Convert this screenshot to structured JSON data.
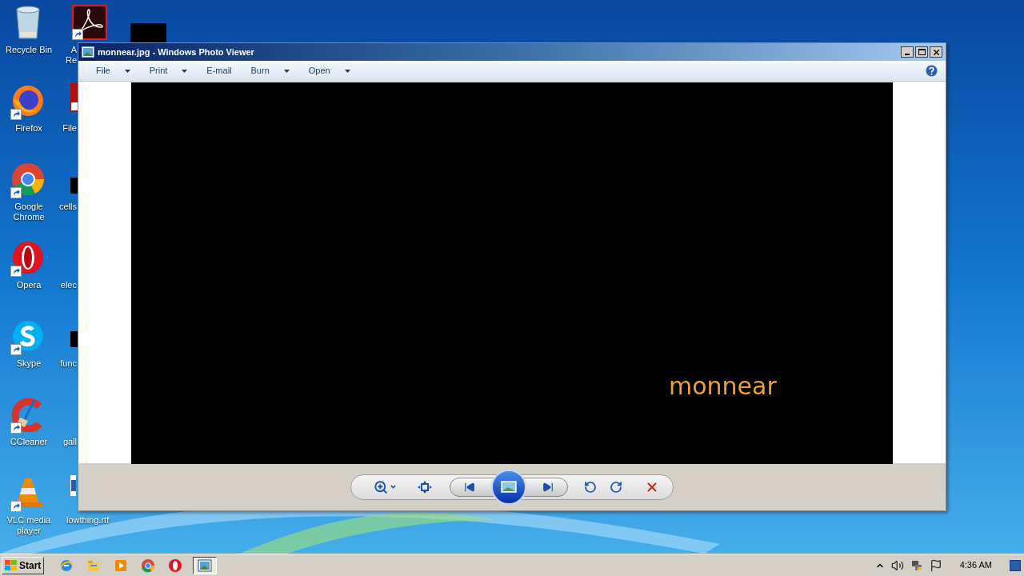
{
  "desktop_icons": [
    {
      "label": "Recycle Bin",
      "shortcut": false
    },
    {
      "label": "Firefox",
      "shortcut": true
    },
    {
      "label": "Google Chrome",
      "shortcut": true
    },
    {
      "label": "Opera",
      "shortcut": true
    },
    {
      "label": "Skype",
      "shortcut": true
    },
    {
      "label": "CCleaner",
      "shortcut": true
    },
    {
      "label": "VLC media player",
      "shortcut": true
    }
  ],
  "desktop_icons_2": [
    {
      "lines": [
        "A",
        "Re"
      ]
    },
    {
      "lines": [
        "File"
      ]
    },
    {
      "lines": [
        "cells"
      ]
    },
    {
      "lines": [
        "elec"
      ]
    },
    {
      "lines": [
        "func"
      ]
    },
    {
      "lines": [
        "gall"
      ]
    },
    {
      "lines": [
        "lowthing.rtf"
      ]
    }
  ],
  "window": {
    "title": "monnear.jpg - Windows Photo Viewer",
    "menu": [
      {
        "label": "File",
        "dropdown": true
      },
      {
        "label": "Print",
        "dropdown": true
      },
      {
        "label": "E-mail",
        "dropdown": false
      },
      {
        "label": "Burn",
        "dropdown": true
      },
      {
        "label": "Open",
        "dropdown": true
      }
    ],
    "image_text": "monnear"
  },
  "taskbar": {
    "start": "Start",
    "buttons": [
      {
        "selected": false
      },
      {
        "selected": false
      },
      {
        "selected": false
      },
      {
        "selected": false
      },
      {
        "selected": false
      },
      {
        "selected": true
      }
    ],
    "clock": "4:36 AM"
  }
}
